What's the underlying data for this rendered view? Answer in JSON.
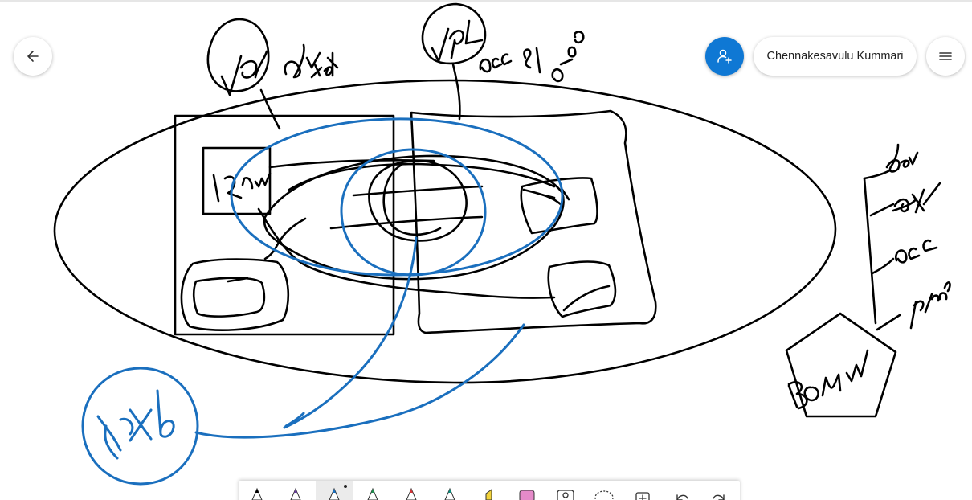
{
  "app": {
    "user_name": "Chennakesavulu Kummari"
  },
  "header": {
    "back_icon": "arrow-left-icon",
    "invite_icon": "add-person-icon",
    "menu_icon": "hamburger-icon",
    "accent_color": "#0f78d4"
  },
  "canvas": {
    "ink_black": "#000000",
    "ink_blue": "#1a6fbe",
    "labels": [
      "VPC",
      "dev",
      "xsx",
      "VPC",
      "acc",
      "sp",
      "prod",
      "12 nw",
      "rxb",
      "dev",
      "Qsit",
      "acc",
      "prod",
      "BMW"
    ]
  },
  "toolbar": {
    "tools": [
      {
        "name": "pen-black",
        "icon": "pen-icon",
        "color": "#000000"
      },
      {
        "name": "pen-purple",
        "icon": "pen-icon",
        "color": "#6b3fa0"
      },
      {
        "name": "pen-blue",
        "icon": "pen-icon",
        "color": "#1a6fbe",
        "active": true
      },
      {
        "name": "pen-green",
        "icon": "pen-icon",
        "color": "#1e8c4e"
      },
      {
        "name": "pen-red",
        "icon": "pen-icon",
        "color": "#d13438"
      },
      {
        "name": "pen-teal",
        "icon": "pen-icon",
        "color": "#0b8a7a"
      },
      {
        "name": "highlighter-yellow",
        "icon": "highlighter-icon",
        "color": "#f2d33b"
      },
      {
        "name": "eraser",
        "icon": "eraser-icon",
        "color": "#e58ac9"
      },
      {
        "name": "image",
        "icon": "image-icon",
        "color": "#333333"
      },
      {
        "name": "lasso",
        "icon": "lasso-icon",
        "color": "#333333"
      },
      {
        "name": "add-page",
        "icon": "add-page-icon",
        "color": "#333333"
      },
      {
        "name": "undo",
        "icon": "undo-icon",
        "color": "#333333"
      },
      {
        "name": "redo",
        "icon": "redo-icon",
        "color": "#333333"
      }
    ]
  }
}
